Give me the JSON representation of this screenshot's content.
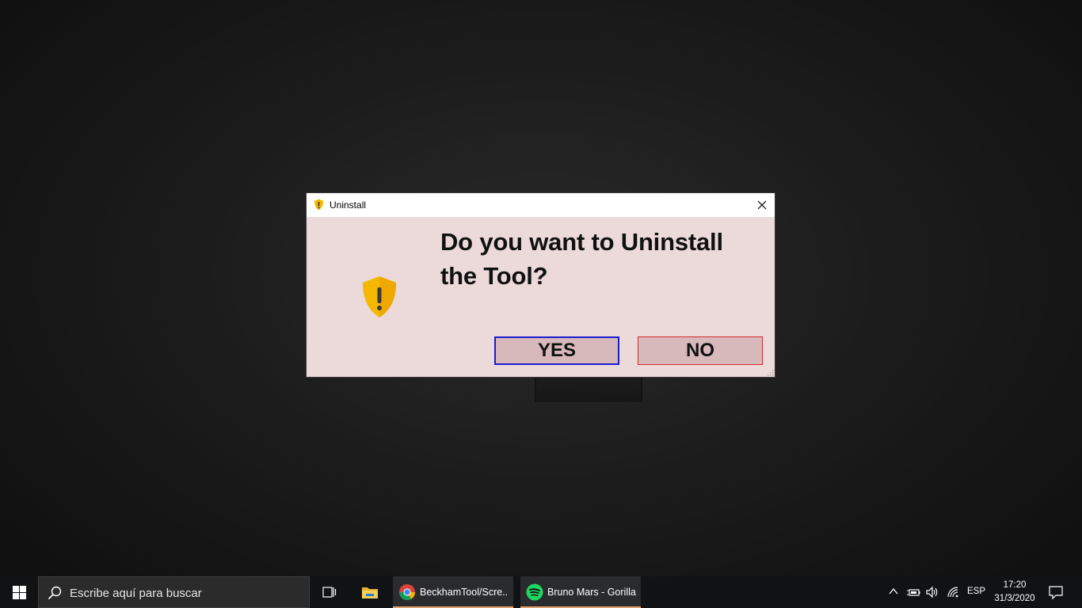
{
  "dialog": {
    "title": "Uninstall",
    "question": "Do you want to Uninstall the Tool?",
    "yes_label": "YES",
    "no_label": "NO",
    "icon": "warning-shield-icon",
    "colors": {
      "background": "#ecdada",
      "button_bg": "#d8b9bb",
      "yes_border": "#1a1acd",
      "no_border": "#d62a2a",
      "shield": "#f5b800"
    }
  },
  "taskbar": {
    "search_placeholder": "Escribe aquí para buscar",
    "apps": [
      {
        "label": "BeckhamTool/Scre...",
        "icon": "chrome-icon"
      },
      {
        "label": "Bruno Mars - Gorilla",
        "icon": "spotify-icon"
      }
    ],
    "language": "ESP",
    "time": "17:20",
    "date": "31/3/2020",
    "accent": "#e2a06c"
  }
}
